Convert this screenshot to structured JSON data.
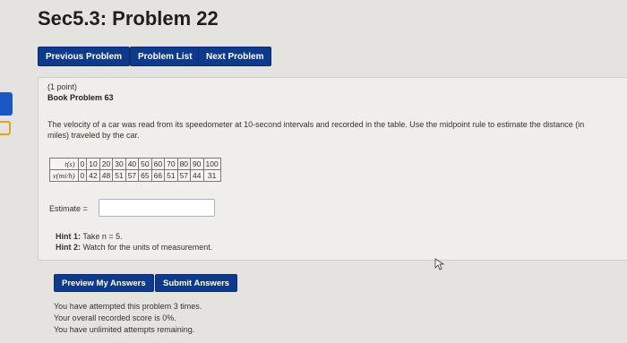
{
  "page": {
    "title": "Sec5.3: Problem 22"
  },
  "nav": {
    "previous": "Previous Problem",
    "list": "Problem List",
    "next": "Next Problem"
  },
  "problem": {
    "points": "(1 point)",
    "book": "Book Problem 63",
    "statement": "The velocity of a car was read from its speedometer at 10-second intervals and recorded in the table. Use the midpoint rule to estimate the distance (in miles) traveled by the car.",
    "table": {
      "row1_header": "t(s)",
      "row1": [
        "0",
        "10",
        "20",
        "30",
        "40",
        "50",
        "60",
        "70",
        "80",
        "90",
        "100"
      ],
      "row2_header": "v(mi/h)",
      "row2": [
        "0",
        "42",
        "48",
        "51",
        "57",
        "65",
        "66",
        "51",
        "57",
        "44",
        "31"
      ]
    },
    "estimate_label": "Estimate =",
    "estimate_value": "",
    "hint1_label": "Hint 1:",
    "hint1_text": " Take n = 5.",
    "hint2_label": "Hint 2:",
    "hint2_text": " Watch for the units of measurement."
  },
  "actions": {
    "preview": "Preview My Answers",
    "submit": "Submit Answers"
  },
  "status": {
    "line1": "You have attempted this problem 3 times.",
    "line2": "Your overall recorded score is 0%.",
    "line3": "You have unlimited attempts remaining."
  }
}
